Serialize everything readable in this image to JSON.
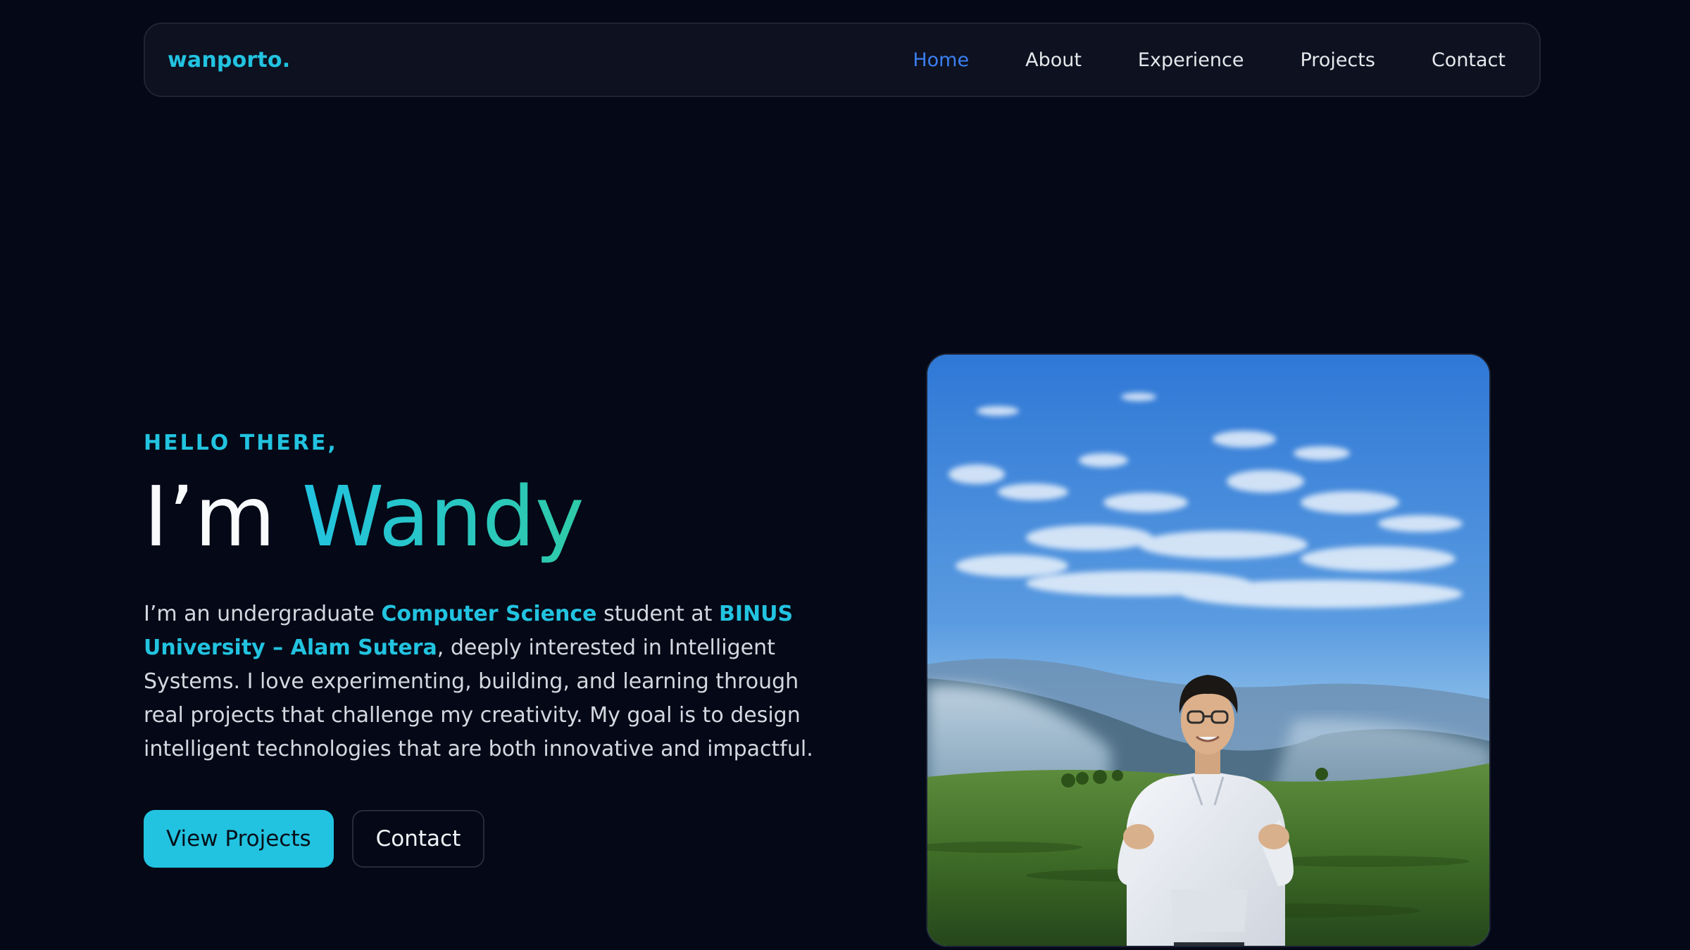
{
  "nav": {
    "logo": "wanporto.",
    "links": [
      {
        "label": "Home",
        "active": true
      },
      {
        "label": "About",
        "active": false
      },
      {
        "label": "Experience",
        "active": false
      },
      {
        "label": "Projects",
        "active": false
      },
      {
        "label": "Contact",
        "active": false
      }
    ]
  },
  "hero": {
    "greeting": "HELLO THERE,",
    "headline_prefix": "I’m ",
    "name": "Wandy",
    "bio": {
      "part1": "I’m an undergraduate ",
      "highlight1": "Computer Science",
      "part2": " student at ",
      "highlight2": "BINUS University – Alam Sutera",
      "part3": ", deeply interested in Intelligent Systems. I love experimenting, building, and learning through real projects that challenge my creativity. My goal is to design intelligent technologies that are both innovative and impactful."
    },
    "primary_button": "View Projects",
    "secondary_button": "Contact"
  },
  "photo": {
    "subject": "person in white hoodie standing in tea plantation under blue sky"
  },
  "colors": {
    "background": "#050816",
    "accent": "#22c3e0",
    "active_link": "#3b7ff0"
  }
}
